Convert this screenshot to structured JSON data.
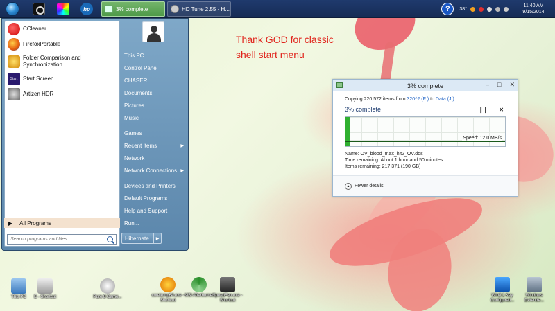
{
  "taskbar": {
    "tasks": [
      {
        "label": "3% complete",
        "icon": "copy-progress-icon",
        "active": true
      },
      {
        "label": "HD Tune 2.55 - H...",
        "icon": "hard-disk-icon",
        "active": false
      }
    ],
    "hp_label": "hp",
    "tray": {
      "temperature": "38°"
    },
    "clock": {
      "time": "11:40 AM",
      "date": "9/15/2014"
    }
  },
  "start_menu": {
    "programs": [
      {
        "label": "CCleaner",
        "icon": "ccleaner-icon"
      },
      {
        "label": "FirefoxPortable",
        "icon": "firefox-icon"
      },
      {
        "label": "Folder Comparison and Synchronization",
        "icon": "folder-sync-icon"
      },
      {
        "label": "Start Screen",
        "icon": "start-screen-icon"
      },
      {
        "label": "Artizen HDR",
        "icon": "artizen-icon"
      }
    ],
    "start_icon_text": "Start",
    "all_programs": "All Programs",
    "search_placeholder": "Search programs and files",
    "right_links": [
      {
        "label": "This PC",
        "has_arrow": false
      },
      {
        "label": "Control Panel",
        "has_arrow": false
      },
      {
        "label": "CHASER",
        "has_arrow": false
      },
      {
        "label": "Documents",
        "has_arrow": false
      },
      {
        "label": "Pictures",
        "has_arrow": false
      },
      {
        "label": "Music",
        "has_arrow": false
      },
      {
        "sep": true
      },
      {
        "label": "Games",
        "has_arrow": false
      },
      {
        "label": "Recent Items",
        "has_arrow": true
      },
      {
        "label": "Network",
        "has_arrow": false
      },
      {
        "label": "Network Connections",
        "has_arrow": true
      },
      {
        "sep": true
      },
      {
        "label": "Devices and Printers",
        "has_arrow": false
      },
      {
        "label": "Default Programs",
        "has_arrow": false
      },
      {
        "label": "Help and Support",
        "has_arrow": false
      },
      {
        "label": "Run...",
        "has_arrow": false
      }
    ],
    "shutdown_label": "Hibernate"
  },
  "annotation": {
    "line1": "Thank GOD for classic",
    "line2": "shell start menu"
  },
  "copy_dialog": {
    "title": "3% complete",
    "copying_prefix": "Copying 220,572 items from ",
    "source": "320^2 (F:)",
    "to_word": " to ",
    "destination": "Data (J:)",
    "percent_text": "3% complete",
    "progress_fraction": 0.03,
    "speed": "Speed: 12.0 MB/s",
    "name": "Name:  OV_blood_max_hit2_OV.dds",
    "time_remaining": "Time remaining:  About 1 hour and 50 minutes",
    "items_remaining": "Items remaining:  217,371 (190 GB)",
    "fewer_details": "Fewer details"
  },
  "desktop_icons": [
    {
      "label": "This PC",
      "icon": "this-pc-icon"
    },
    {
      "label": "E - Shortcut",
      "icon": "drive-shortcut-icon"
    },
    {
      "label": "Pure 8 Game...",
      "icon": "mouse-icon"
    },
    {
      "label": "coretemp64.exe - Shortcut",
      "icon": "info-icon"
    },
    {
      "label": "MSI Afterburner",
      "icon": "msi-afterburner-icon"
    },
    {
      "label": "SpeedFan.exe - Shortcut",
      "icon": "speedfan-icon"
    },
    {
      "label": "Win8.1 Key Configurati...",
      "icon": "windows-key-icon"
    },
    {
      "label": "Windows Defende...",
      "icon": "windows-defender-icon"
    }
  ]
}
